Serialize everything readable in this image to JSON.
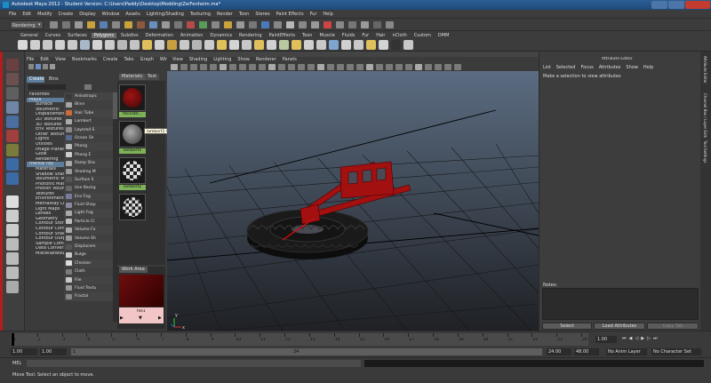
{
  "window": {
    "title": "Autodesk Maya 2012 - Student Version: C:\\Users\\Paddy\\Desktop\\Modding\\ZeiFenheim.ma*"
  },
  "main_menu": [
    "File",
    "Edit",
    "Modify",
    "Create",
    "Display",
    "Window",
    "Assets",
    "Lighting/Shading",
    "Texturing",
    "Render",
    "Toon",
    "Stereo",
    "Paint Effects",
    "Fur",
    "Help"
  ],
  "menu_set": "Rendering",
  "shelf_tabs": [
    "General",
    "Curves",
    "Surfaces",
    "Polygons",
    "Subdivs",
    "Deformation",
    "Animation",
    "Dynamics",
    "Rendering",
    "PaintEffects",
    "Toon",
    "Muscle",
    "Fluids",
    "Fur",
    "Hair",
    "nCloth",
    "Custom",
    "DMM"
  ],
  "shelf_active": "Polygons",
  "hypershade": {
    "menu": [
      "File",
      "Edit",
      "View",
      "Bookmarks",
      "Create",
      "Tabs",
      "Graph",
      "Window"
    ],
    "tabs": [
      "Create",
      "Bins"
    ],
    "tree": [
      "Favorites",
      "Maya",
      "Surface",
      "Volumetric",
      "Displacement",
      "2D Textures",
      "3D Textures",
      "Env Textures",
      "Other Textures",
      "Lights",
      "Utilities",
      "Image Planes",
      "Glow",
      "Rendering",
      "mental ray",
      "Materials",
      "Shadow Shad",
      "Volumetric Ma",
      "Photonic Mate",
      "Photon Volum",
      "Textures",
      "Environments",
      "MentalRay Lig",
      "Light Maps",
      "Lenses",
      "Geometry",
      "Contour Store",
      "Contour Contr",
      "Contour Shade",
      "Contour Outp",
      "Sample Comp",
      "Data Conversi",
      "Miscellaneous"
    ],
    "nodes": [
      "Anisotropic",
      "Blinn",
      "Hair Tube",
      "Lambert",
      "Layered S",
      "Ocean Sh",
      "Phong",
      "Phong E",
      "Ramp Sha",
      "Shading M",
      "Surface S",
      "Use Backg",
      "Env Fog",
      "Fluid Shap",
      "Light Fog",
      "Particle Cl",
      "Volume Fo",
      "Volume Sh",
      "Displacem",
      "Bulge",
      "Checker",
      "Cloth",
      "File",
      "Fluid Textu",
      "Fractal"
    ],
    "materials_tab": "Materials",
    "textures_tab": "Text",
    "swatches": [
      "file1Rbt...",
      "lambert1",
      "lambert2"
    ],
    "tooltip": "lambert1 lambert1",
    "work_area_tab": "Work Area",
    "work_node_label": "file1"
  },
  "viewport": {
    "menu": [
      "View",
      "Shading",
      "Lighting",
      "Show",
      "Renderer",
      "Panels"
    ],
    "axis_labels": [
      "y",
      "z",
      "x"
    ]
  },
  "attribute_editor": {
    "title": "Attribute Editor",
    "menu": [
      "List",
      "Selected",
      "Focus",
      "Attributes",
      "Show",
      "Help"
    ],
    "message": "Make a selection to view attributes",
    "notes_label": "Notes:",
    "buttons": [
      "Select",
      "Load Attributes",
      "Copy Tab"
    ],
    "side_tabs": [
      "Attribute Editor",
      "Channel Box / Layer Editor",
      "Tool Settings"
    ]
  },
  "timeline": {
    "ticks": [
      1,
      2,
      3,
      4,
      5,
      6,
      7,
      8,
      9,
      10,
      11,
      12,
      13,
      14,
      15,
      16,
      17,
      18,
      19,
      20,
      21,
      22,
      23,
      24
    ],
    "current_frame": "1.00",
    "range_start": "1.00",
    "range_start2": "1.00",
    "range_start3": "1",
    "range_marker": "24",
    "range_end": "24.00",
    "range_end2": "48.00",
    "anim_layer": "No Anim Layer",
    "char_set": "No Character Set"
  },
  "command_line": {
    "label": "MEL"
  },
  "help_line": {
    "text": "Move Tool: Select an object to move."
  },
  "colors": {
    "accent_green": "#84b35c",
    "selection_blue": "#5d7d9a",
    "model_red": "#a31010"
  }
}
